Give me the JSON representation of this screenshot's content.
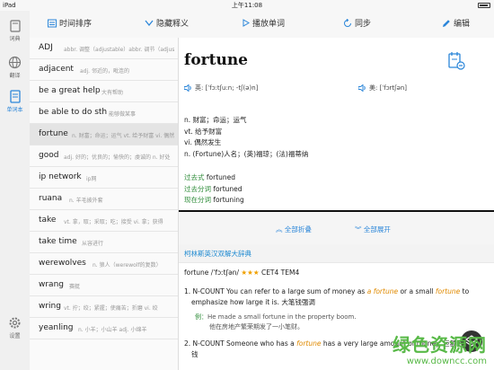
{
  "status": {
    "left": "iPad",
    "time": "上午11:08"
  },
  "sidebar": [
    {
      "label": "词典",
      "icon": "book-icon"
    },
    {
      "label": "翻译",
      "icon": "globe-icon"
    },
    {
      "label": "单词本",
      "icon": "notebook-icon"
    },
    {
      "label": "设置",
      "icon": "gear-icon"
    }
  ],
  "toolbar": {
    "sort": "时间排序",
    "hide": "隐藏释义",
    "play": "播放单词",
    "sync": "同步",
    "edit": "编辑"
  },
  "words": [
    {
      "word": "ADJ",
      "def": "abbr. 调整（adjustable）abbr. 调节（adjus"
    },
    {
      "word": "adjacent",
      "def": "adj. 邻近的，毗连的"
    },
    {
      "word": "be a great help",
      "def": "大有帮助"
    },
    {
      "word": "be able to do sth",
      "def": "能够做某事"
    },
    {
      "word": "fortune",
      "def": "n. 财富；命运；运气 vt. 给予财富 vi. 偶然"
    },
    {
      "word": "good",
      "def": "adj. 好的；优良的；愉快的；虔诚的 n. 好处"
    },
    {
      "word": "ip network",
      "def": "ip网"
    },
    {
      "word": "ruana",
      "def": "n. 羊毛披外套"
    },
    {
      "word": "take",
      "def": "vt. 拿，取；采取；吃；接受 vi. 拿；获得"
    },
    {
      "word": "take time",
      "def": "从容进行"
    },
    {
      "word": "werewolves",
      "def": "n. 狼人（werewolf的复数）"
    },
    {
      "word": "wrang",
      "def": "赛艇"
    },
    {
      "word": "wring",
      "def": "vt. 拧；绞；紧握；使痛苦；折磨 vi. 绞"
    },
    {
      "word": "yeanling",
      "def": "n. 小羊；小山羊 adj. 小绵羊"
    }
  ],
  "entry": {
    "word": "fortune",
    "uk_label": "英: [ˈfɔ:tʃu:n; -tʃ(ə)n]",
    "us_label": "美: [ˈfɔrtʃən]",
    "defs": [
      "n. 财富；命运；运气",
      "vt. 给予财富",
      "vi. 偶然发生",
      "n. (Fortune)人名；(英)福琼；(法)福蒂纳"
    ],
    "forms": [
      {
        "k": "过去式",
        "v": "fortuned"
      },
      {
        "k": "过去分词",
        "v": "fortuned"
      },
      {
        "k": "现在分词",
        "v": "fortuning"
      }
    ],
    "fold_all": "全部折叠",
    "expand_all": "全部展开",
    "dict_title": "柯林斯英汉双解大辞典",
    "collins_head": "fortune /ˈfɔːtʃən/",
    "stars": "★★★",
    "level": "CET4 TEM4",
    "sense1_a": "1. N-COUNT You can refer to a large sum of money as ",
    "sense1_hl1": "a fortune",
    "sense1_b": " or ",
    "sense1_c": "a small ",
    "sense1_hl2": "fortune",
    "sense1_d": " to",
    "sense1_e": "emphasize how large it is. 大笔钱强调",
    "ex_label": "例：",
    "ex1_en": "He made a small fortune in the property boom.",
    "ex1_cn": "他在房地产繁荣期发了一小笔财。",
    "sense2_a": "2. N-COUNT Someone who has a ",
    "sense2_hl": "fortune",
    "sense2_b": " has a very large amount of money. 巨额的",
    "sense2_c": "钱"
  },
  "watermark": {
    "line1": "绿色资源网",
    "line2": "www.downcc.com"
  }
}
